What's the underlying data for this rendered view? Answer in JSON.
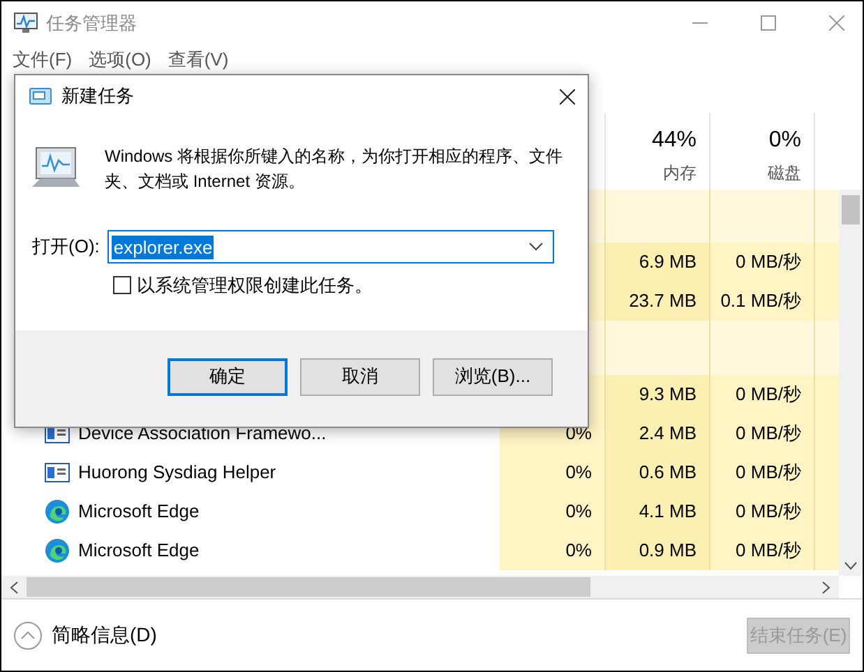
{
  "window": {
    "title": "任务管理器"
  },
  "menu": [
    "文件(F)",
    "选项(O)",
    "查看(V)"
  ],
  "table": {
    "columns": [
      {
        "value": "44%",
        "label": "内存"
      },
      {
        "value": "0%",
        "label": "磁盘"
      }
    ],
    "rows": [
      {
        "kind": "group"
      },
      {
        "kind": "process",
        "memory": "6.9 MB",
        "disk": "0 MB/秒"
      },
      {
        "kind": "process",
        "memory": "23.7 MB",
        "disk": "0.1 MB/秒"
      },
      {
        "kind": "group"
      },
      {
        "kind": "process",
        "memory": "9.3 MB",
        "disk": "0 MB/秒"
      },
      {
        "kind": "window",
        "name": "Device Association Framewo...",
        "cpu": "0%",
        "memory": "2.4 MB",
        "disk": "0 MB/秒"
      },
      {
        "kind": "window",
        "name": "Huorong Sysdiag Helper",
        "cpu": "0%",
        "memory": "0.6 MB",
        "disk": "0 MB/秒"
      },
      {
        "kind": "edge",
        "name": "Microsoft Edge",
        "cpu": "0%",
        "memory": "4.1 MB",
        "disk": "0 MB/秒"
      },
      {
        "kind": "edge",
        "name": "Microsoft Edge",
        "cpu": "0%",
        "memory": "0.9 MB",
        "disk": "0 MB/秒"
      }
    ]
  },
  "footer": {
    "details": "简略信息(D)",
    "end_task": {
      "label": "结束任务(E)",
      "disabled": true
    }
  },
  "dialog": {
    "title": "新建任务",
    "description": "Windows 将根据你所键入的名称，为你打开相应的程序、文件夹、文档或 Internet 资源。",
    "open_label": "打开(O):",
    "value": "explorer.exe",
    "admin": {
      "label": "以系统管理权限创建此任务。",
      "checked": false
    },
    "buttons": [
      {
        "label": "确定",
        "default": true
      },
      {
        "label": "取消",
        "default": false
      },
      {
        "label": "浏览(B)...",
        "default": false
      }
    ]
  }
}
